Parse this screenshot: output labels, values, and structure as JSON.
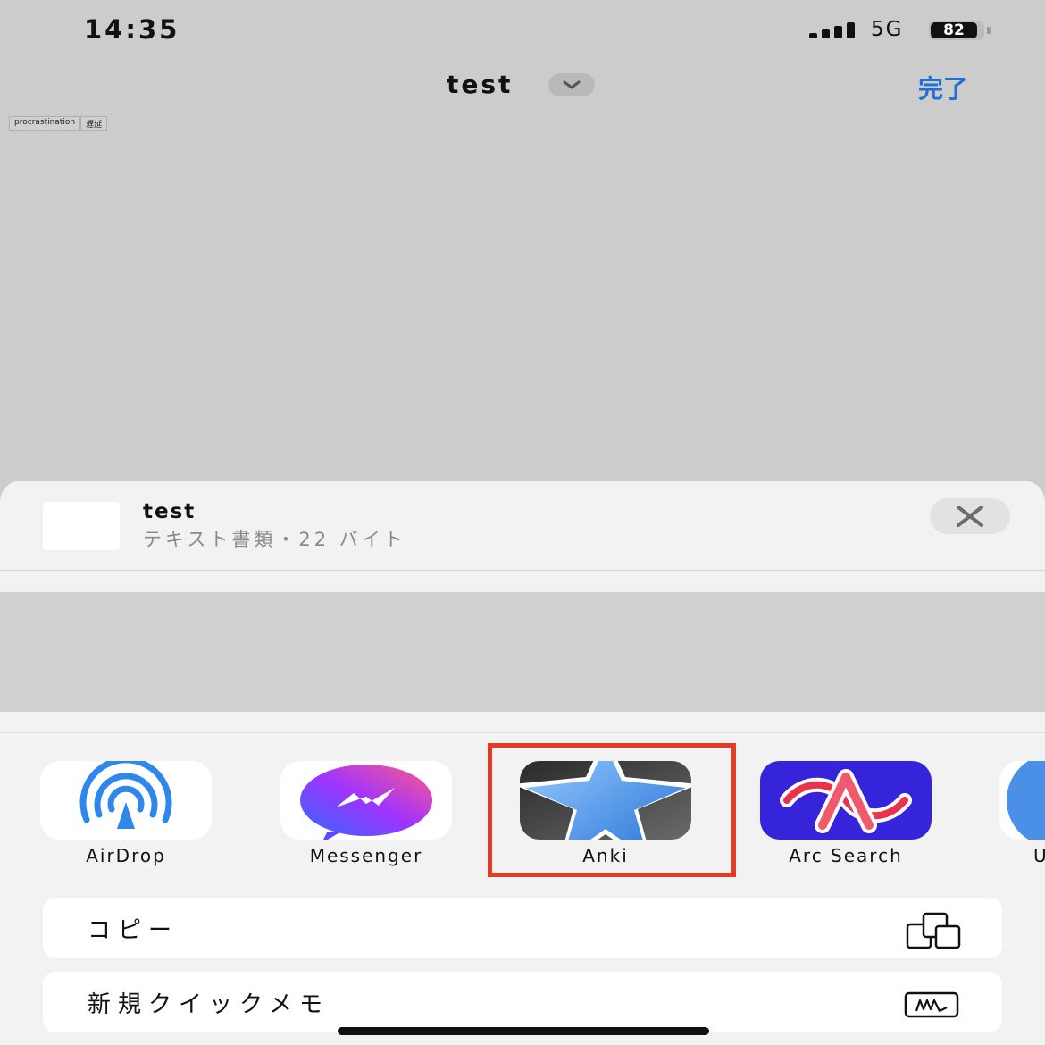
{
  "status_bar": {
    "time": "14:35",
    "network": "5G",
    "battery": "82"
  },
  "nav": {
    "title": "test",
    "done_label": "完了"
  },
  "document_cells": [
    "procrastination",
    "遅延"
  ],
  "share_sheet": {
    "file_name": "test",
    "file_meta": "テキスト書類・22 バイト",
    "apps": [
      {
        "label": "AirDrop",
        "icon": "airdrop-icon"
      },
      {
        "label": "Messenger",
        "icon": "messenger-icon"
      },
      {
        "label": "Anki",
        "icon": "anki-icon"
      },
      {
        "label": "Arc Search",
        "icon": "arc-search-icon"
      },
      {
        "label": "U",
        "icon": "partial-app-icon"
      }
    ],
    "actions": [
      {
        "label": "コピー",
        "icon": "copy-icon"
      },
      {
        "label": "新規クイックメモ",
        "icon": "quick-note-icon"
      }
    ]
  },
  "colors": {
    "accent_blue": "#1f6fd6",
    "highlight_red": "#e53b23",
    "sheet_bg": "#f2f2f2"
  }
}
